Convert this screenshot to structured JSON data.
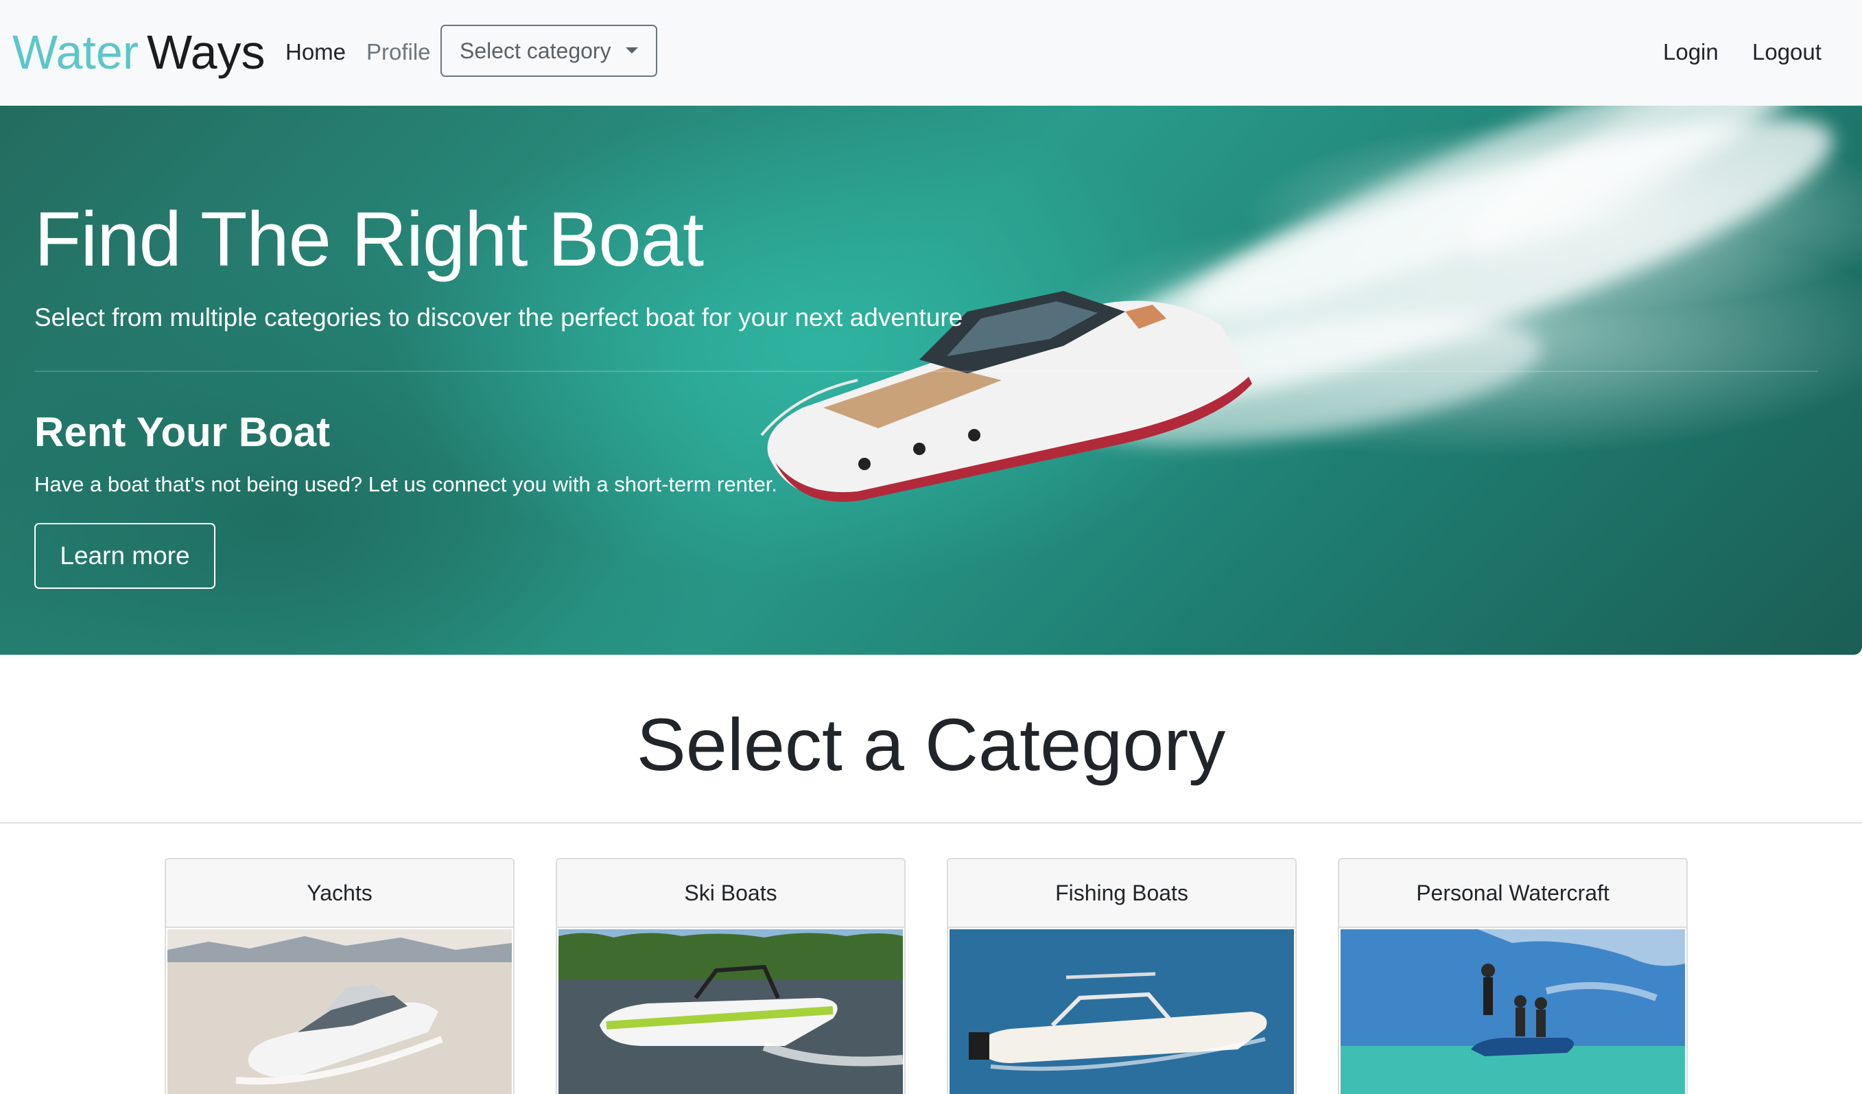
{
  "navbar": {
    "brand_part1": "Water",
    "brand_part2": "Ways",
    "home_label": "Home",
    "profile_label": "Profile",
    "category_select_label": "Select category",
    "login_label": "Login",
    "logout_label": "Logout"
  },
  "hero": {
    "title": "Find The Right Boat",
    "lead": "Select from multiple categories to discover the perfect boat for your next adventure",
    "subtitle": "Rent Your Boat",
    "text": "Have a boat that's not being used? Let us connect you with a short-term renter.",
    "button_label": "Learn more"
  },
  "categories_section": {
    "title": "Select a Category",
    "cards": [
      {
        "title": "Yachts"
      },
      {
        "title": "Ski Boats"
      },
      {
        "title": "Fishing Boats"
      },
      {
        "title": "Personal Watercraft"
      }
    ]
  },
  "colors": {
    "brand_accent": "#5bc6cc",
    "navbar_bg": "#f8f9fa",
    "text_dark": "#212529",
    "text_muted": "#6c757d"
  },
  "icons": {
    "dropdown": "chevron-down-icon"
  }
}
